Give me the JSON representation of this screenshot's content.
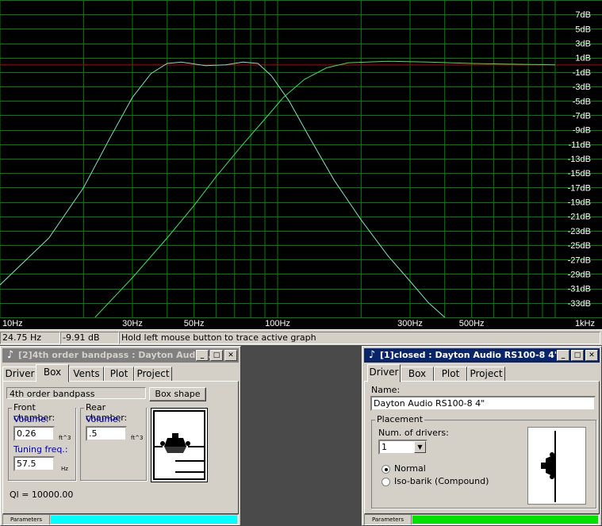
{
  "graph": {
    "x_labels": [
      {
        "text": "10Hz",
        "hz": 10
      },
      {
        "text": "30Hz",
        "hz": 30
      },
      {
        "text": "50Hz",
        "hz": 50
      },
      {
        "text": "100Hz",
        "hz": 100
      },
      {
        "text": "300Hz",
        "hz": 300
      },
      {
        "text": "500Hz",
        "hz": 500
      },
      {
        "text": "1kHz",
        "hz": 1000
      }
    ],
    "y_labels": [
      "7dB",
      "5dB",
      "3dB",
      "1dB",
      "-1dB",
      "-3dB",
      "-5dB",
      "-7dB",
      "-9dB",
      "-11dB",
      "-13dB",
      "-15dB",
      "-17dB",
      "-19dB",
      "-21dB",
      "-23dB",
      "-25dB",
      "-27dB",
      "-29dB",
      "-31dB",
      "-33dB"
    ],
    "colors": {
      "background": "#000000",
      "grid": "#008000",
      "reference": "#c00000",
      "bandpass_curve": "#80e0c8",
      "closed_curve": "#40e060",
      "labels": "#ffffff"
    }
  },
  "status": {
    "frequency": "24.75 Hz",
    "level": "-9.91 dB",
    "hint": "Hold left mouse button to trace active graph"
  },
  "win_bandpass": {
    "title": "[2]4th order bandpass : Dayton Audio ...",
    "tabs": [
      "Driver",
      "Box",
      "Vents",
      "Plot",
      "Project"
    ],
    "box_type": "4th order bandpass",
    "box_shape_btn": "Box shape",
    "front_title": "Front chamber:",
    "front_volume_label": "Volume:",
    "front_volume": "0.26",
    "front_unit": "ft^3",
    "tuning_label": "Tuning freq.:",
    "tuning_value": "57.5",
    "tuning_unit": "Hz",
    "rear_title": "Rear chamber:",
    "rear_volume_label": "Volume:",
    "rear_volume": ".5",
    "rear_unit": "ft^3",
    "ql_text": "Ql = 10000.00",
    "params_label": "Parameters",
    "progress_color": "#00ffff"
  },
  "win_closed": {
    "title": "[1]closed : Dayton Audio RS100-8 4\"",
    "tabs": [
      "Driver",
      "Box",
      "Plot",
      "Project"
    ],
    "name_label": "Name:",
    "name_value": "Dayton Audio RS100-8 4\"",
    "placement_title": "Placement",
    "num_drivers_label": "Num. of drivers:",
    "num_drivers_value": "1",
    "radio_normal": "Normal",
    "radio_iso": "Iso-barik (Compound)",
    "params_label": "Parameters",
    "progress_color": "#00e000"
  }
}
